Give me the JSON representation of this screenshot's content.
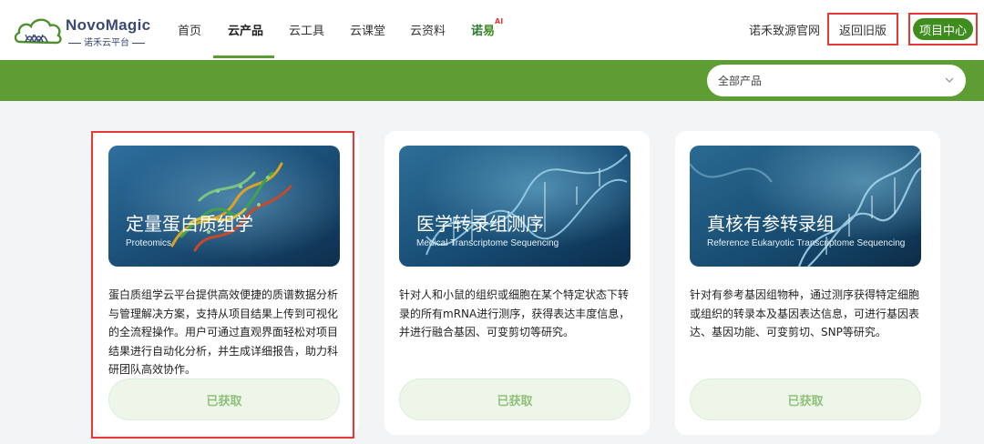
{
  "brand": {
    "name": "NovoMagic",
    "sub": "诺禾云平台"
  },
  "nav": {
    "items": [
      {
        "label": "首页"
      },
      {
        "label": "云产品"
      },
      {
        "label": "云工具"
      },
      {
        "label": "云课堂"
      },
      {
        "label": "云资料"
      }
    ],
    "ai_brand": {
      "part1": "诺",
      "part2": "易",
      "badge": "AI"
    }
  },
  "header_right": {
    "official_site": "诺禾致源官网",
    "old_version": "返回旧版",
    "project_center": "项目中心"
  },
  "filter": {
    "selected": "全部产品"
  },
  "cards": [
    {
      "title": "定量蛋白质组学",
      "subtitle": "Proteomics",
      "description": "蛋白质组学云平台提供高效便捷的质谱数据分析与管理解决方案，支持从项目结果上传到可视化的全流程操作。用户可通过直观界面轻松对项目结果进行自动化分析，并生成详细报告，助力科研团队高效协作。",
      "button": "已获取"
    },
    {
      "title": "医学转录组测序",
      "subtitle": "Medical Transcriptome Sequencing",
      "description": "针对人和小鼠的组织或细胞在某个特定状态下转录的所有mRNA进行测序，获得表达丰度信息，并进行融合基因、可变剪切等研究。",
      "button": "已获取"
    },
    {
      "title": "真核有参转录组",
      "subtitle": "Reference Eukaryotic Transcriptome Sequencing",
      "description": "针对有参考基因组物种，通过测序获得特定细胞或组织的转录本及基因表达信息，可进行基因表达、基因功能、可变剪切、SNP等研究。",
      "button": "已获取"
    }
  ],
  "colors": {
    "brand_green": "#5e9c34",
    "primary_button": "#3f8d1e",
    "highlight_red": "#e53935",
    "logo_navy": "#3a4a72"
  }
}
